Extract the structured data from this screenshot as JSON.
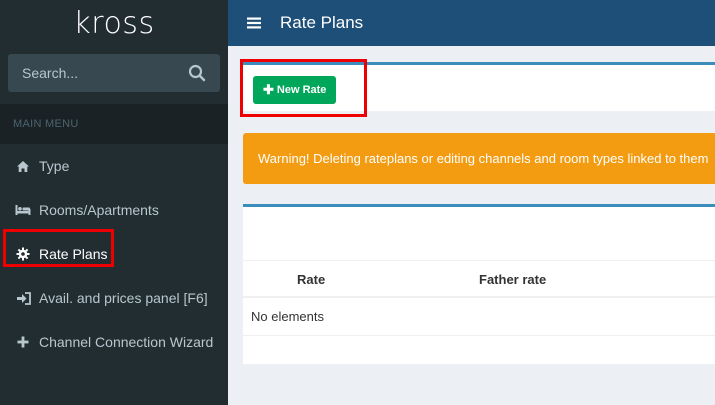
{
  "app": {
    "logo": "kross"
  },
  "header": {
    "title": "Rate Plans"
  },
  "sidebar": {
    "search_placeholder": "Search...",
    "menu_header": "MAIN MENU",
    "items": [
      {
        "label": "Type",
        "icon": "home-icon"
      },
      {
        "label": "Rooms/Apartments",
        "icon": "bed-icon"
      },
      {
        "label": "Rate Plans",
        "icon": "gear-icon",
        "active": true
      },
      {
        "label": "Avail. and prices panel [F6]",
        "icon": "sign-in-icon"
      },
      {
        "label": "Channel Connection Wizard",
        "icon": "plus-icon"
      }
    ]
  },
  "toolbar": {
    "new_rate_label": "New Rate"
  },
  "warning": {
    "text": "Warning! Deleting rateplans or editing channels and room types linked to them"
  },
  "table": {
    "columns": [
      "Rate",
      "Father rate"
    ],
    "empty_text": "No elements"
  },
  "colors": {
    "sidebar_bg": "#222d32",
    "header_bg": "#1e4f78",
    "accent_border": "#3c8dbc",
    "new_button": "#00a65a",
    "warning_bg": "#f39c12",
    "highlight": "#ee0000"
  }
}
